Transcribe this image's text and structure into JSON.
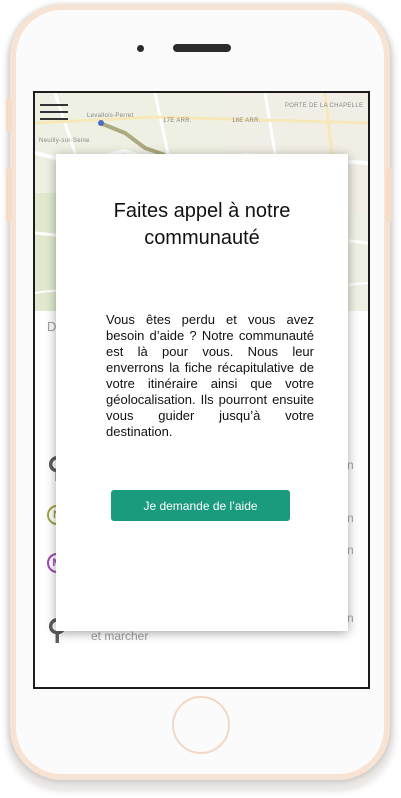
{
  "map": {
    "labels": [
      "Levallois-Perret",
      "17E ARR.",
      "18E ARR.",
      "Neuilly-sur-Seine",
      "PORTE DE LA CHAPELLE"
    ]
  },
  "menu": {
    "icon": "hamburger-menu-icon"
  },
  "background": {
    "section_letter": "D",
    "side_texts": [
      "n",
      "n",
      "n",
      "n"
    ],
    "walk_icons": [
      "walk-icon",
      "walk-icon"
    ],
    "line_badges": [
      {
        "label": "N",
        "color": "#9aa035"
      },
      {
        "label": "M",
        "color": "#9b3fb1"
      }
    ],
    "last_step_caption": "et marcher"
  },
  "modal": {
    "title": "Faites appel à notre communauté",
    "body": "Vous êtes perdu et vous avez besoin d’aide ? Notre communauté est là pour vous. Nous leur enverrons la fiche récapitulative de votre itinéraire ainsi que votre géolocalisation. Ils pourront ensuite vous guider jusqu’à votre destination.",
    "button_label": "Je demande de l’aide",
    "button_color": "#1a9b7d"
  }
}
